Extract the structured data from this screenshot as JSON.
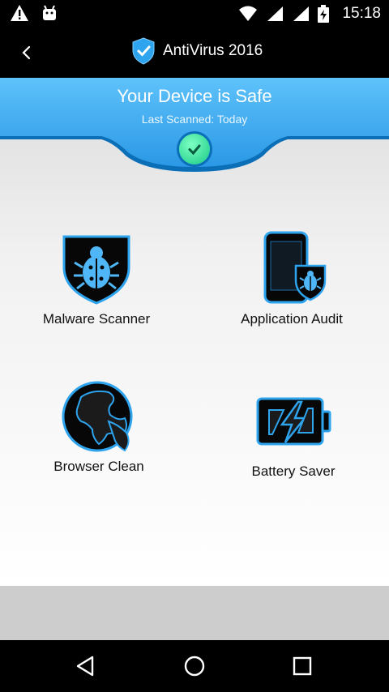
{
  "status_bar": {
    "time": "15:18"
  },
  "app_bar": {
    "title": "AntiVirus 2016"
  },
  "banner": {
    "title": "Your Device is Safe",
    "subtitle": "Last Scanned: Today"
  },
  "tools": [
    {
      "label": "Malware Scanner",
      "icon": "bug-shield-icon"
    },
    {
      "label": "Application Audit",
      "icon": "phone-shield-icon"
    },
    {
      "label": "Browser Clean",
      "icon": "globe-icon"
    },
    {
      "label": "Battery Saver",
      "icon": "battery-icon"
    }
  ],
  "colors": {
    "accent": "#1e9cf0",
    "banner": "#3fb0f4",
    "dark_blue": "#0b6fb8",
    "safe_green": "#18c986"
  }
}
